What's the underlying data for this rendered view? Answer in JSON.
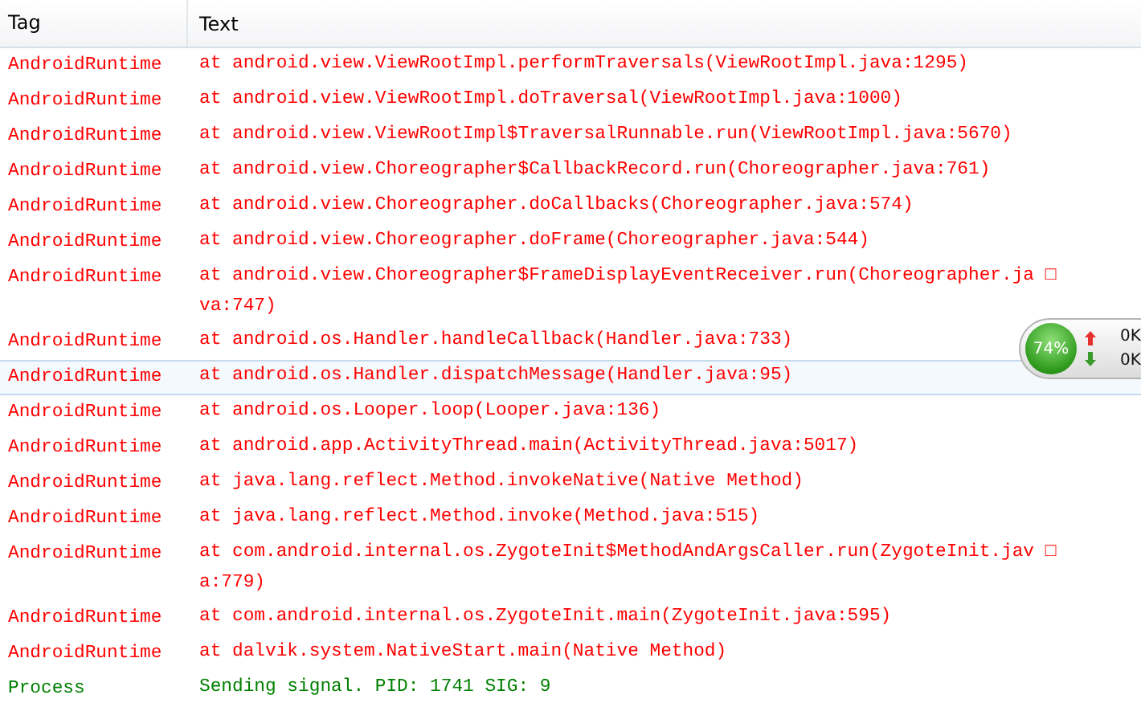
{
  "table": {
    "columns": [
      "Tag",
      "Text"
    ],
    "rows": [
      {
        "tag": "AndroidRuntime",
        "kind": "error",
        "selected": false,
        "lines": [
          "at android.view.ViewRootImpl.performTraversals(ViewRootImpl.java:1295)"
        ]
      },
      {
        "tag": "AndroidRuntime",
        "kind": "error",
        "selected": false,
        "lines": [
          "at android.view.ViewRootImpl.doTraversal(ViewRootImpl.java:1000)"
        ]
      },
      {
        "tag": "AndroidRuntime",
        "kind": "error",
        "selected": false,
        "lines": [
          "at android.view.ViewRootImpl$TraversalRunnable.run(ViewRootImpl.java:5670)"
        ]
      },
      {
        "tag": "AndroidRuntime",
        "kind": "error",
        "selected": false,
        "lines": [
          "at android.view.Choreographer$CallbackRecord.run(Choreographer.java:761)"
        ]
      },
      {
        "tag": "AndroidRuntime",
        "kind": "error",
        "selected": false,
        "lines": [
          "at android.view.Choreographer.doCallbacks(Choreographer.java:574)"
        ]
      },
      {
        "tag": "AndroidRuntime",
        "kind": "error",
        "selected": false,
        "lines": [
          "at android.view.Choreographer.doFrame(Choreographer.java:544)"
        ]
      },
      {
        "tag": "AndroidRuntime",
        "kind": "error",
        "selected": false,
        "lines": [
          "at android.view.Choreographer$FrameDisplayEventReceiver.run(Choreographer.ja □",
          "va:747)"
        ]
      },
      {
        "tag": "AndroidRuntime",
        "kind": "error",
        "selected": false,
        "lines": [
          "at android.os.Handler.handleCallback(Handler.java:733)"
        ]
      },
      {
        "tag": "AndroidRuntime",
        "kind": "error",
        "selected": true,
        "lines": [
          "at android.os.Handler.dispatchMessage(Handler.java:95)"
        ]
      },
      {
        "tag": "AndroidRuntime",
        "kind": "error",
        "selected": false,
        "lines": [
          "at android.os.Looper.loop(Looper.java:136)"
        ]
      },
      {
        "tag": "AndroidRuntime",
        "kind": "error",
        "selected": false,
        "lines": [
          "at android.app.ActivityThread.main(ActivityThread.java:5017)"
        ]
      },
      {
        "tag": "AndroidRuntime",
        "kind": "error",
        "selected": false,
        "lines": [
          "at java.lang.reflect.Method.invokeNative(Native Method)"
        ]
      },
      {
        "tag": "AndroidRuntime",
        "kind": "error",
        "selected": false,
        "lines": [
          "at java.lang.reflect.Method.invoke(Method.java:515)"
        ]
      },
      {
        "tag": "AndroidRuntime",
        "kind": "error",
        "selected": false,
        "lines": [
          "at com.android.internal.os.ZygoteInit$MethodAndArgsCaller.run(ZygoteInit.jav □",
          "a:779)"
        ]
      },
      {
        "tag": "AndroidRuntime",
        "kind": "error",
        "selected": false,
        "lines": [
          "at com.android.internal.os.ZygoteInit.main(ZygoteInit.java:595)"
        ]
      },
      {
        "tag": "AndroidRuntime",
        "kind": "error",
        "selected": false,
        "lines": [
          "at dalvik.system.NativeStart.main(Native Method)"
        ]
      },
      {
        "tag": "Process",
        "kind": "info",
        "selected": false,
        "lines": [
          "Sending signal. PID: 1741 SIG: 9"
        ]
      }
    ]
  },
  "speed_widget": {
    "percent": "74%",
    "upload": "0K",
    "download": "0K"
  }
}
